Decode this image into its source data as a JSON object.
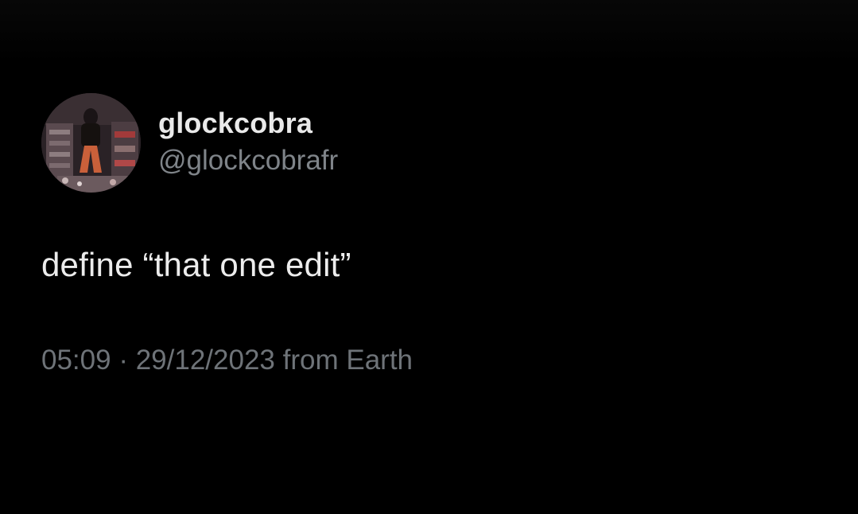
{
  "tweet": {
    "author": {
      "display_name": "glockcobra",
      "handle": "@glockcobrafr",
      "avatar_icon": "avatar-photo"
    },
    "text": "define “that one edit”",
    "meta": {
      "time": "05:09",
      "separator": "·",
      "date": "29/12/2023",
      "source": "from Earth"
    }
  },
  "colors": {
    "background": "#000000",
    "primary_text": "#e9e9e9",
    "secondary_text": "#7f8489"
  }
}
